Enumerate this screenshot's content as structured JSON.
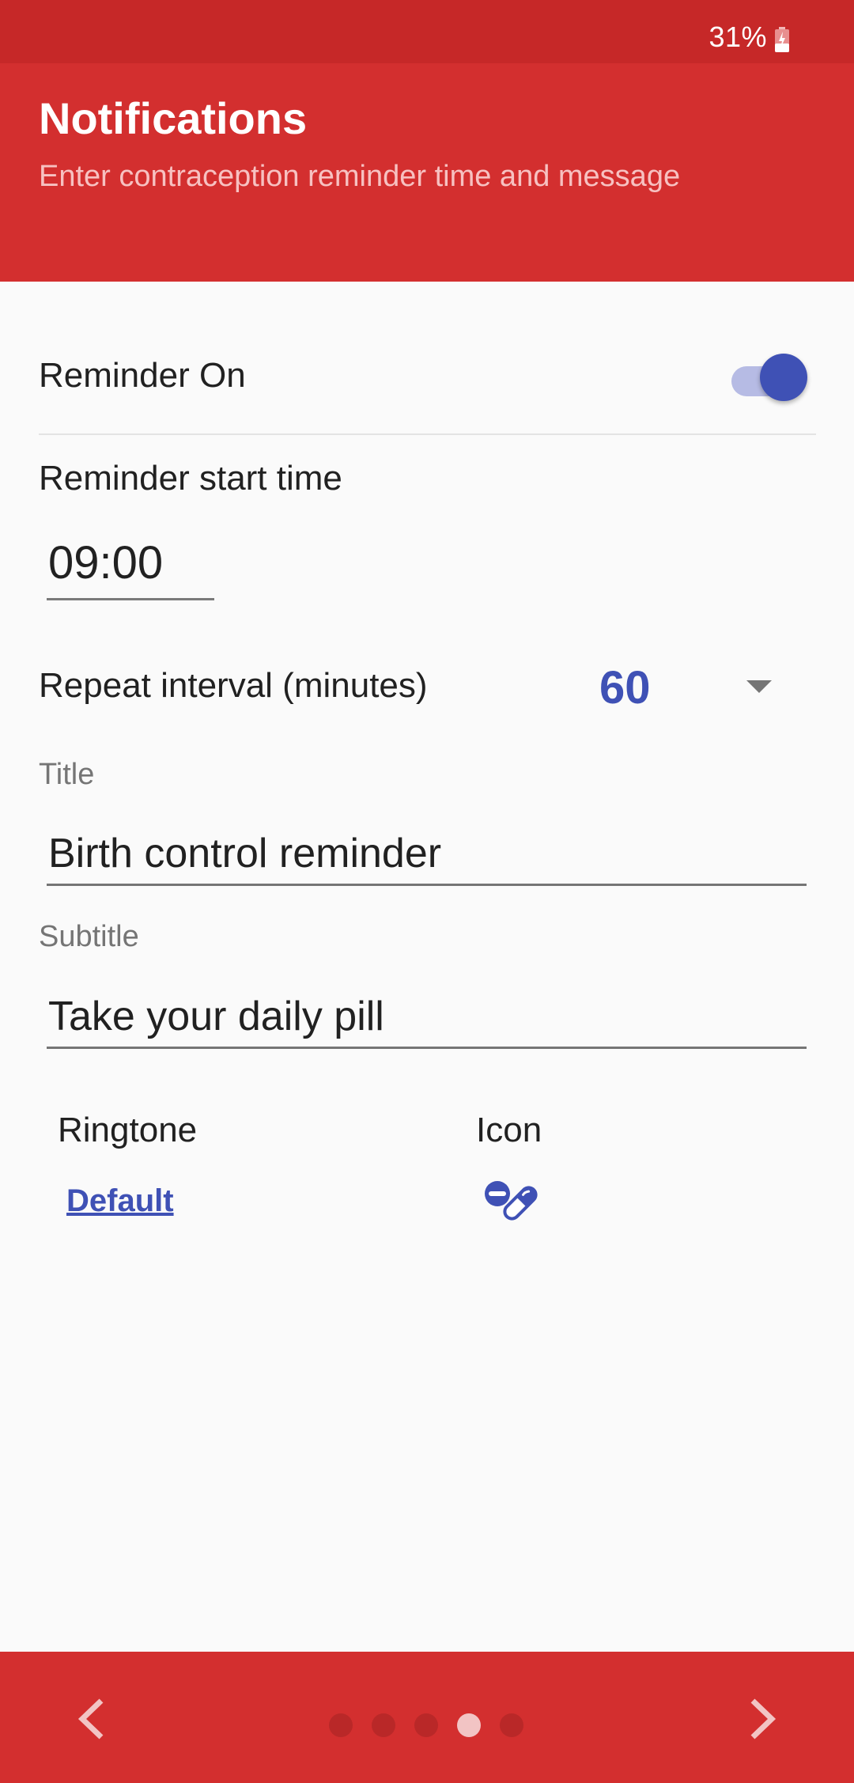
{
  "status_bar": {
    "battery_percent": "31%",
    "battery_state": "charging"
  },
  "header": {
    "title": "Notifications",
    "subtitle": "Enter contraception reminder time and message"
  },
  "reminder_toggle": {
    "label": "Reminder On",
    "on": true
  },
  "start_time": {
    "label": "Reminder start time",
    "value": "09:00"
  },
  "repeat_interval": {
    "label": "Repeat interval (minutes)",
    "selected": "60"
  },
  "title_field": {
    "label": "Title",
    "value": "Birth control reminder"
  },
  "subtitle_field": {
    "label": "Subtitle",
    "value": "Take your daily pill"
  },
  "ringtone": {
    "label": "Ringtone",
    "value": "Default"
  },
  "icon_picker": {
    "label": "Icon",
    "selected_icon": "pills-icon"
  },
  "footer": {
    "prev_icon": "chevron-left-icon",
    "next_icon": "chevron-right-icon",
    "page_count": 5,
    "current_page": 4
  },
  "colors": {
    "primary": "#d32f2f",
    "primary_dark": "#c62828",
    "accent": "#3f51b5"
  }
}
